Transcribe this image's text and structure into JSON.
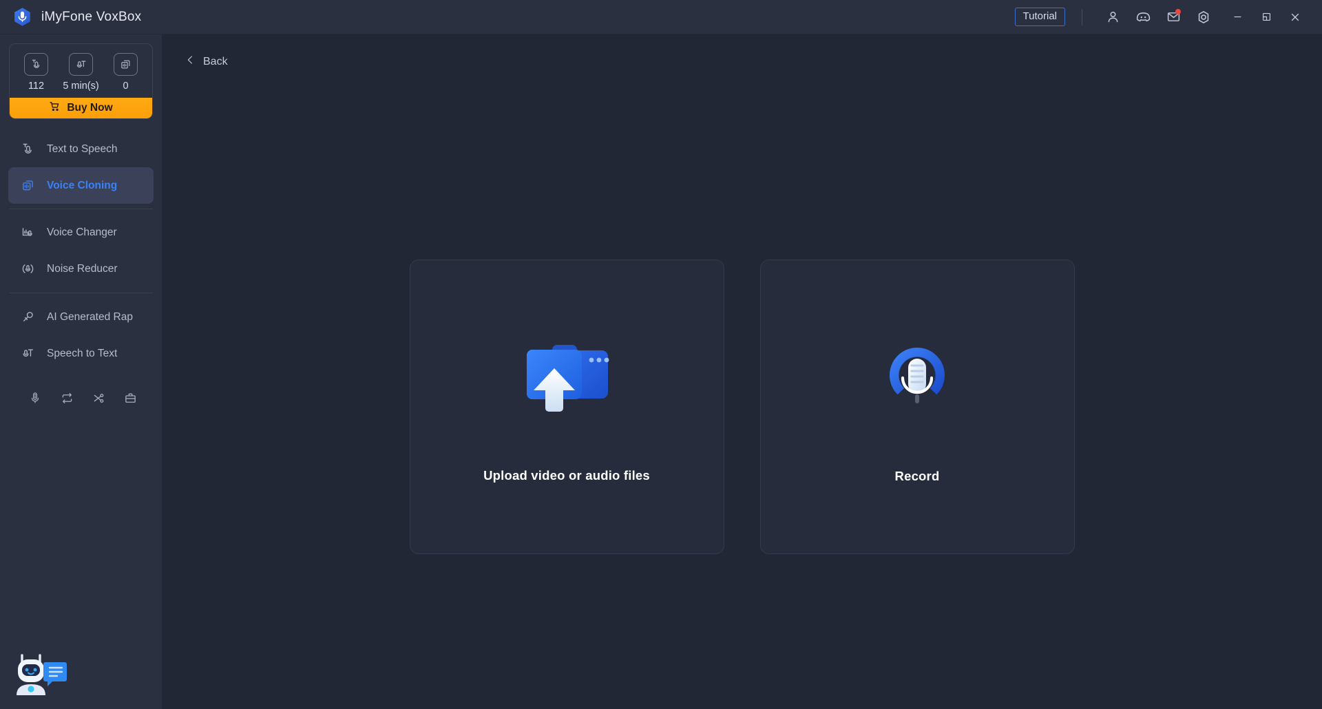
{
  "window": {
    "title": "iMyFone VoxBox",
    "logo_icon": "voxbox-mic-hex-logo",
    "controls": {
      "tutorial_label": "Tutorial",
      "account_icon": "person-icon",
      "discord_icon": "discord-icon",
      "mail_icon": "mail-icon",
      "settings_icon": "settings-gear-icon",
      "minimize_icon": "minimize-icon",
      "maximize_icon": "maximize-restore-icon",
      "close_icon": "close-icon",
      "mail_has_badge": true
    }
  },
  "sidebar": {
    "credits": [
      {
        "icon": "text-to-speech-icon",
        "value": "112"
      },
      {
        "icon": "speech-to-text-icon",
        "value": "5 min(s)"
      },
      {
        "icon": "voice-cloning-icon",
        "value": "0"
      }
    ],
    "buy_label": "Buy Now",
    "buy_icon": "cart-icon",
    "items": [
      {
        "label": "Text to Speech",
        "icon": "text-to-speech-icon",
        "active": false
      },
      {
        "label": "Voice Cloning",
        "icon": "voice-cloning-icon",
        "active": true
      },
      {
        "label": "Voice Changer",
        "icon": "voice-changer-icon",
        "active": false
      },
      {
        "label": "Noise Reducer",
        "icon": "noise-reducer-icon",
        "active": false
      },
      {
        "label": "AI Generated Rap",
        "icon": "ai-rap-icon",
        "active": false
      },
      {
        "label": "Speech to Text",
        "icon": "speech-to-text-icon",
        "active": false
      }
    ],
    "tools": [
      {
        "icon": "microphone-icon"
      },
      {
        "icon": "loop-convert-icon"
      },
      {
        "icon": "scissors-cut-icon"
      },
      {
        "icon": "toolbox-icon"
      }
    ],
    "bot_icon": "chatbot-assistant-icon"
  },
  "main": {
    "back_label": "Back",
    "back_icon": "chevron-left-icon",
    "cards": [
      {
        "label": "Upload video or audio files",
        "icon": "upload-folder-icon"
      },
      {
        "label": "Record",
        "icon": "record-microphone-icon"
      }
    ]
  },
  "colors": {
    "accent_blue": "#3b82f6",
    "buy_orange": "#fb9f08",
    "sidebar_bg": "#2b3040",
    "main_bg": "#222736",
    "card_bg": "#272c3c",
    "badge_red": "#f0443e"
  }
}
